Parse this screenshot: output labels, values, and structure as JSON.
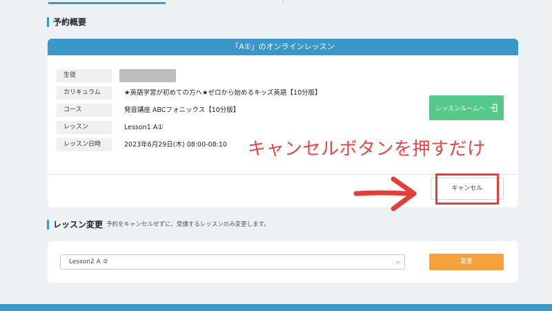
{
  "summary": {
    "title": "予約概要",
    "card_header": "「A①」のオンラインレッスン",
    "rows": [
      {
        "label": "生徒",
        "value": ""
      },
      {
        "label": "カリキュラム",
        "value": "★英語学習が初めての方へ★ゼロから始めるキッズ英語【10分版】"
      },
      {
        "label": "コース",
        "value": "発音講座 ABCフォニックス【10分版】"
      },
      {
        "label": "レッスン",
        "value": "Lesson1 A①"
      },
      {
        "label": "レッスン日時",
        "value": "2023年6月29日(木) 08:00-08:10"
      }
    ],
    "lesson_room_button": "レッスンルームへ",
    "cancel_button": "キャンセル"
  },
  "annotation": {
    "text": "キャンセルボタンを押すだけ",
    "color": "#e94545"
  },
  "change": {
    "title": "レッスン変更",
    "subtitle": "予約をキャンセルせずに、受講するレッスンのみ変更します。",
    "selected_lesson": "Lesson2 A ②",
    "change_button": "変更"
  },
  "colors": {
    "accent": "#3b97c7",
    "lesson_room": "#56c98a",
    "change": "#f6a23a"
  },
  "icons": {
    "lesson_room": "enter-icon",
    "select": "chevron-down-icon",
    "annotation": "arrow-right-icon"
  }
}
